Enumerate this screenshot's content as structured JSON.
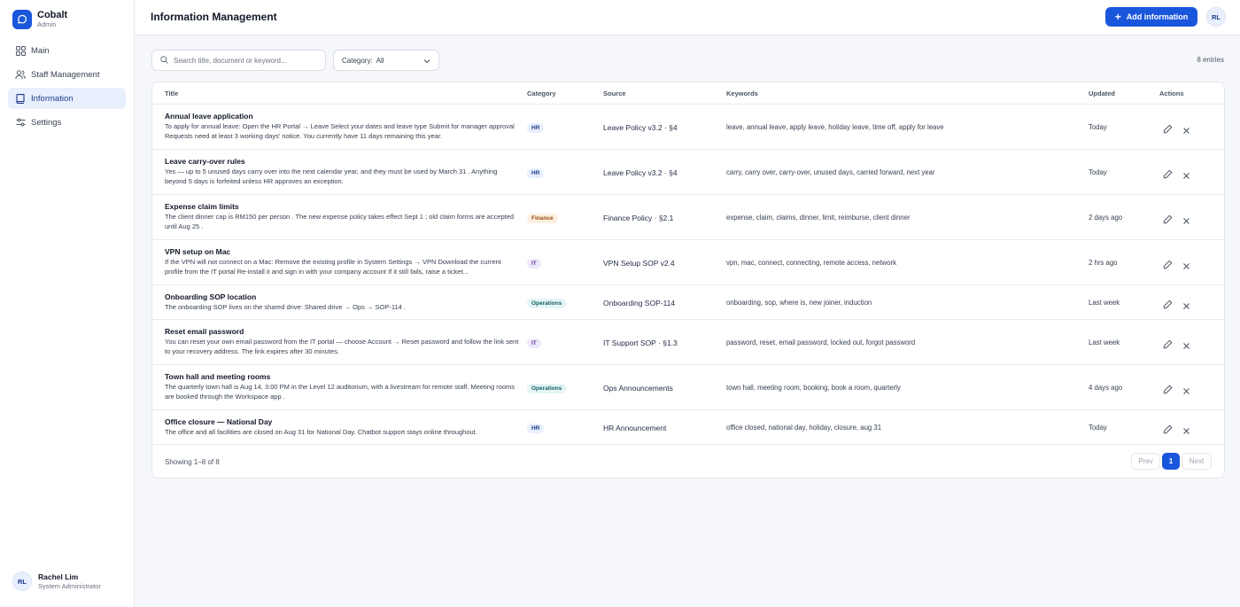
{
  "brand": {
    "name": "Cobalt",
    "role": "Admin",
    "logo_icon": "chat-bubble-icon",
    "color": "#1a56db"
  },
  "sidebar": {
    "items": [
      {
        "label": "Main",
        "icon": "grid-icon",
        "active": false
      },
      {
        "label": "Staff Management",
        "icon": "users-icon",
        "active": false
      },
      {
        "label": "Information",
        "icon": "book-icon",
        "active": true
      },
      {
        "label": "Settings",
        "icon": "sliders-icon",
        "active": false
      }
    ]
  },
  "user": {
    "initials": "RL",
    "name": "Rachel Lim",
    "role": "System Administrator"
  },
  "header": {
    "title": "Information Management",
    "add_label": "Add information",
    "avatar_initials": "RL"
  },
  "toolbar": {
    "search_placeholder": "Search title, document or keyword...",
    "category_label": "Category:",
    "category_value": "All",
    "entries": "8 entries"
  },
  "table": {
    "columns": {
      "title": "Title",
      "category": "Category",
      "source": "Source",
      "keywords": "Keywords",
      "updated": "Updated",
      "actions": "Actions"
    },
    "rows": [
      {
        "title": "Annual leave application",
        "desc": "To apply for annual leave: Open the HR Portal → Leave Select your dates and leave type Submit for manager approval Requests need at least 3 working days' notice. You currently have 11 days remaining this year.",
        "category": "HR",
        "source": "Leave Policy v3.2 · §4",
        "keywords": "leave, annual leave, apply leave, holiday leave, time off, apply for leave",
        "updated": "Today"
      },
      {
        "title": "Leave carry-over rules",
        "desc": "Yes — up to 5 unused days carry over into the next calendar year, and they must be used by March 31 . Anything beyond 5 days is forfeited unless HR approves an exception.",
        "category": "HR",
        "source": "Leave Policy v3.2 · §4",
        "keywords": "carry, carry over, carry-over, unused days, carried forward, next year",
        "updated": "Today"
      },
      {
        "title": "Expense claim limits",
        "desc": "The client dinner cap is RM150 per person . The new expense policy takes effect Sept 1 ; old claim forms are accepted until Aug 25 .",
        "category": "Finance",
        "source": "Finance Policy · §2.1",
        "keywords": "expense, claim, claims, dinner, limit, reimburse, client dinner",
        "updated": "2 days ago"
      },
      {
        "title": "VPN setup on Mac",
        "desc": "If the VPN will not connect on a Mac: Remove the existing profile in System Settings → VPN Download the current profile from the IT portal Re-install it and sign in with your company account If it still fails, raise a ticket...",
        "category": "IT",
        "source": "VPN Setup SOP v2.4",
        "keywords": "vpn, mac, connect, connecting, remote access, network",
        "updated": "2 hrs ago"
      },
      {
        "title": "Onboarding SOP location",
        "desc": "The onboarding SOP lives on the shared drive: Shared drive → Ops → SOP-114 .",
        "category": "Operations",
        "source": "Onboarding SOP-114",
        "keywords": "onboarding, sop, where is, new joiner, induction",
        "updated": "Last week"
      },
      {
        "title": "Reset email password",
        "desc": "You can reset your own email password from the IT portal — choose Account → Reset password and follow the link sent to your recovery address. The link expires after 30 minutes.",
        "category": "IT",
        "source": "IT Support SOP · §1.3",
        "keywords": "password, reset, email password, locked out, forgot password",
        "updated": "Last week"
      },
      {
        "title": "Town hall and meeting rooms",
        "desc": "The quarterly town hall is Aug 14, 3:00 PM in the Level 12 auditorium, with a livestream for remote staff. Meeting rooms are booked through the Workspace app .",
        "category": "Operations",
        "source": "Ops Announcements",
        "keywords": "town hall, meeting room, booking, book a room, quarterly",
        "updated": "4 days ago"
      },
      {
        "title": "Office closure — National Day",
        "desc": "The office and all facilities are closed on Aug 31 for National Day. Chatbot support stays online throughout.",
        "category": "HR",
        "source": "HR Announcement",
        "keywords": "office closed, national day, holiday, closure, aug 31",
        "updated": "Today"
      }
    ]
  },
  "pagination": {
    "showing": "Showing 1–8 of 8",
    "prev": "Prev",
    "current": "1",
    "next": "Next"
  }
}
